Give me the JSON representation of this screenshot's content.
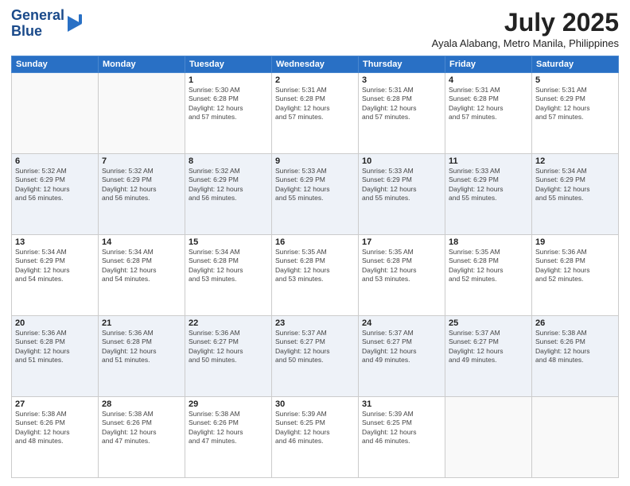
{
  "header": {
    "logo_line1": "General",
    "logo_line2": "Blue",
    "month_title": "July 2025",
    "location": "Ayala Alabang, Metro Manila, Philippines"
  },
  "weekdays": [
    "Sunday",
    "Monday",
    "Tuesday",
    "Wednesday",
    "Thursday",
    "Friday",
    "Saturday"
  ],
  "weeks": [
    [
      {
        "day": "",
        "info": ""
      },
      {
        "day": "",
        "info": ""
      },
      {
        "day": "1",
        "info": "Sunrise: 5:30 AM\nSunset: 6:28 PM\nDaylight: 12 hours\nand 57 minutes."
      },
      {
        "day": "2",
        "info": "Sunrise: 5:31 AM\nSunset: 6:28 PM\nDaylight: 12 hours\nand 57 minutes."
      },
      {
        "day": "3",
        "info": "Sunrise: 5:31 AM\nSunset: 6:28 PM\nDaylight: 12 hours\nand 57 minutes."
      },
      {
        "day": "4",
        "info": "Sunrise: 5:31 AM\nSunset: 6:28 PM\nDaylight: 12 hours\nand 57 minutes."
      },
      {
        "day": "5",
        "info": "Sunrise: 5:31 AM\nSunset: 6:29 PM\nDaylight: 12 hours\nand 57 minutes."
      }
    ],
    [
      {
        "day": "6",
        "info": "Sunrise: 5:32 AM\nSunset: 6:29 PM\nDaylight: 12 hours\nand 56 minutes."
      },
      {
        "day": "7",
        "info": "Sunrise: 5:32 AM\nSunset: 6:29 PM\nDaylight: 12 hours\nand 56 minutes."
      },
      {
        "day": "8",
        "info": "Sunrise: 5:32 AM\nSunset: 6:29 PM\nDaylight: 12 hours\nand 56 minutes."
      },
      {
        "day": "9",
        "info": "Sunrise: 5:33 AM\nSunset: 6:29 PM\nDaylight: 12 hours\nand 55 minutes."
      },
      {
        "day": "10",
        "info": "Sunrise: 5:33 AM\nSunset: 6:29 PM\nDaylight: 12 hours\nand 55 minutes."
      },
      {
        "day": "11",
        "info": "Sunrise: 5:33 AM\nSunset: 6:29 PM\nDaylight: 12 hours\nand 55 minutes."
      },
      {
        "day": "12",
        "info": "Sunrise: 5:34 AM\nSunset: 6:29 PM\nDaylight: 12 hours\nand 55 minutes."
      }
    ],
    [
      {
        "day": "13",
        "info": "Sunrise: 5:34 AM\nSunset: 6:29 PM\nDaylight: 12 hours\nand 54 minutes."
      },
      {
        "day": "14",
        "info": "Sunrise: 5:34 AM\nSunset: 6:28 PM\nDaylight: 12 hours\nand 54 minutes."
      },
      {
        "day": "15",
        "info": "Sunrise: 5:34 AM\nSunset: 6:28 PM\nDaylight: 12 hours\nand 53 minutes."
      },
      {
        "day": "16",
        "info": "Sunrise: 5:35 AM\nSunset: 6:28 PM\nDaylight: 12 hours\nand 53 minutes."
      },
      {
        "day": "17",
        "info": "Sunrise: 5:35 AM\nSunset: 6:28 PM\nDaylight: 12 hours\nand 53 minutes."
      },
      {
        "day": "18",
        "info": "Sunrise: 5:35 AM\nSunset: 6:28 PM\nDaylight: 12 hours\nand 52 minutes."
      },
      {
        "day": "19",
        "info": "Sunrise: 5:36 AM\nSunset: 6:28 PM\nDaylight: 12 hours\nand 52 minutes."
      }
    ],
    [
      {
        "day": "20",
        "info": "Sunrise: 5:36 AM\nSunset: 6:28 PM\nDaylight: 12 hours\nand 51 minutes."
      },
      {
        "day": "21",
        "info": "Sunrise: 5:36 AM\nSunset: 6:28 PM\nDaylight: 12 hours\nand 51 minutes."
      },
      {
        "day": "22",
        "info": "Sunrise: 5:36 AM\nSunset: 6:27 PM\nDaylight: 12 hours\nand 50 minutes."
      },
      {
        "day": "23",
        "info": "Sunrise: 5:37 AM\nSunset: 6:27 PM\nDaylight: 12 hours\nand 50 minutes."
      },
      {
        "day": "24",
        "info": "Sunrise: 5:37 AM\nSunset: 6:27 PM\nDaylight: 12 hours\nand 49 minutes."
      },
      {
        "day": "25",
        "info": "Sunrise: 5:37 AM\nSunset: 6:27 PM\nDaylight: 12 hours\nand 49 minutes."
      },
      {
        "day": "26",
        "info": "Sunrise: 5:38 AM\nSunset: 6:26 PM\nDaylight: 12 hours\nand 48 minutes."
      }
    ],
    [
      {
        "day": "27",
        "info": "Sunrise: 5:38 AM\nSunset: 6:26 PM\nDaylight: 12 hours\nand 48 minutes."
      },
      {
        "day": "28",
        "info": "Sunrise: 5:38 AM\nSunset: 6:26 PM\nDaylight: 12 hours\nand 47 minutes."
      },
      {
        "day": "29",
        "info": "Sunrise: 5:38 AM\nSunset: 6:26 PM\nDaylight: 12 hours\nand 47 minutes."
      },
      {
        "day": "30",
        "info": "Sunrise: 5:39 AM\nSunset: 6:25 PM\nDaylight: 12 hours\nand 46 minutes."
      },
      {
        "day": "31",
        "info": "Sunrise: 5:39 AM\nSunset: 6:25 PM\nDaylight: 12 hours\nand 46 minutes."
      },
      {
        "day": "",
        "info": ""
      },
      {
        "day": "",
        "info": ""
      }
    ]
  ]
}
